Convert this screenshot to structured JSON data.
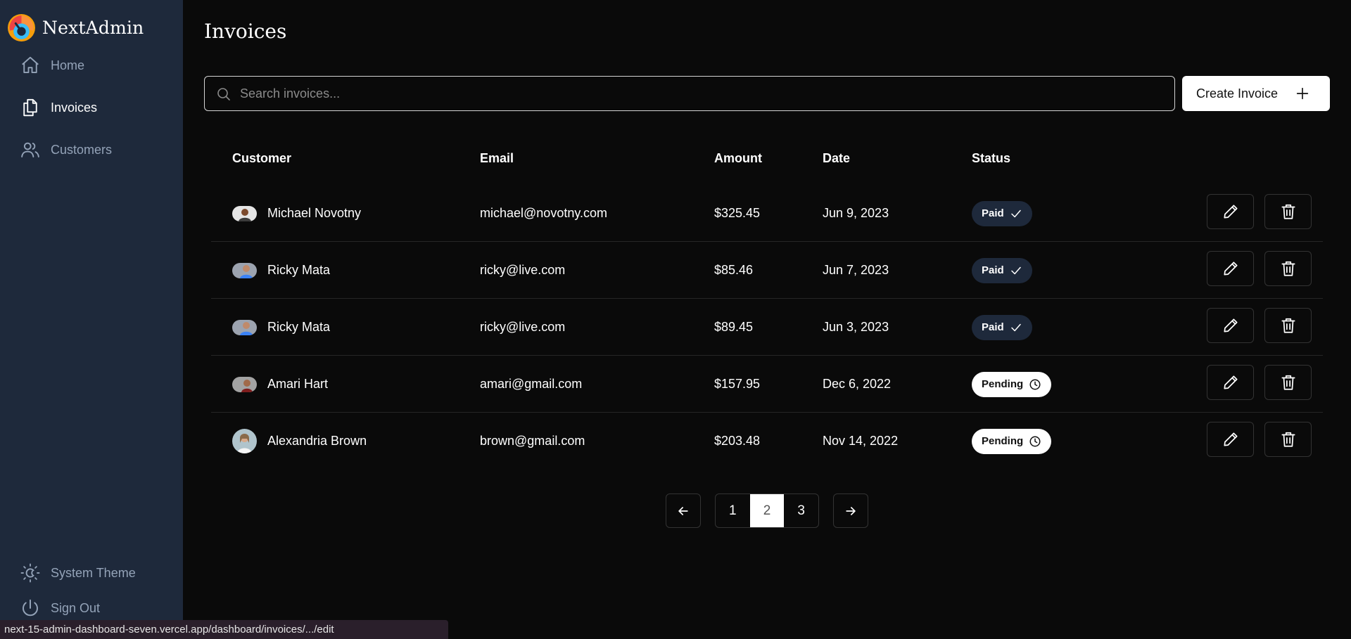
{
  "app": {
    "name": "NextAdmin"
  },
  "sidebar": {
    "items": [
      {
        "label": "Home",
        "icon": "home-icon"
      },
      {
        "label": "Invoices",
        "icon": "document-duplicate-icon",
        "active": true
      },
      {
        "label": "Customers",
        "icon": "users-icon"
      }
    ],
    "footer": [
      {
        "label": "System Theme",
        "icon": "sun-icon"
      },
      {
        "label": "Sign Out",
        "icon": "power-icon"
      }
    ]
  },
  "page": {
    "title": "Invoices"
  },
  "search": {
    "placeholder": "Search invoices..."
  },
  "create_button": {
    "label": "Create Invoice"
  },
  "table": {
    "columns": [
      "Customer",
      "Email",
      "Amount",
      "Date",
      "Status"
    ],
    "rows": [
      {
        "name": "Michael Novotny",
        "email": "michael@novotny.com",
        "amount": "$325.45",
        "date": "Jun 9, 2023",
        "status": "Paid"
      },
      {
        "name": "Ricky Mata",
        "email": "ricky@live.com",
        "amount": "$85.46",
        "date": "Jun 7, 2023",
        "status": "Paid"
      },
      {
        "name": "Ricky Mata",
        "email": "ricky@live.com",
        "amount": "$89.45",
        "date": "Jun 3, 2023",
        "status": "Paid"
      },
      {
        "name": "Amari Hart",
        "email": "amari@gmail.com",
        "amount": "$157.95",
        "date": "Dec 6, 2022",
        "status": "Pending"
      },
      {
        "name": "Alexandria Brown",
        "email": "brown@gmail.com",
        "amount": "$203.48",
        "date": "Nov 14, 2022",
        "status": "Pending"
      }
    ]
  },
  "pagination": {
    "pages": [
      "1",
      "2",
      "3"
    ],
    "current": "2"
  },
  "status_bar": {
    "url": "next-15-admin-dashboard-seven.vercel.app/dashboard/invoices/.../edit"
  },
  "colors": {
    "background": "#0a0a0a",
    "sidebar": "#1e293b",
    "paid_badge": "#1e293b",
    "pending_badge": "#ffffff"
  }
}
